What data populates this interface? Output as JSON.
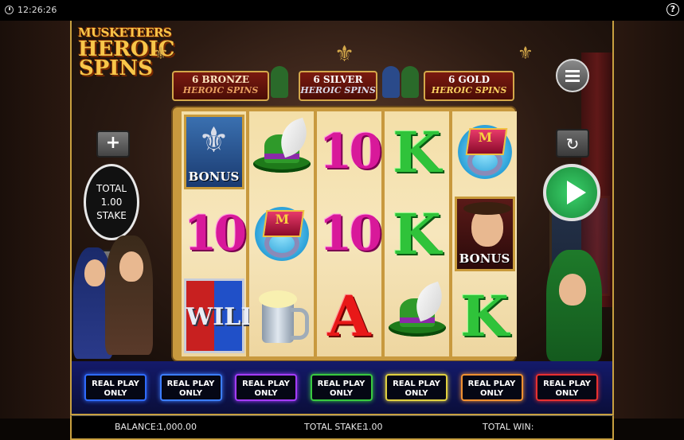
{
  "status": {
    "time": "12:26:26",
    "help_label": "?"
  },
  "logo": {
    "line1": "MUSKETEERS",
    "line2": "HEROIC",
    "line3": "SPINS"
  },
  "banner": {
    "bronze": {
      "count": "6 BRONZE",
      "label": "HEROIC SPINS"
    },
    "silver": {
      "count": "6 SILVER",
      "label": "HEROIC SPINS"
    },
    "gold": {
      "count": "6 GOLD",
      "label": "HEROIC SPINS"
    }
  },
  "reels": [
    [
      "bonus-fleur",
      "ten",
      "wild"
    ],
    [
      "hat",
      "ring",
      "tankard"
    ],
    [
      "ten",
      "ten",
      "ace"
    ],
    [
      "king",
      "king",
      "hat"
    ],
    [
      "ring",
      "bonus-character",
      "king"
    ]
  ],
  "symbols": {
    "ten": "10",
    "king": "K",
    "ace": "A",
    "bonus": "BONUS",
    "wild": "WILD",
    "ring_letter": "M"
  },
  "stake_control": {
    "plus": "+",
    "minus": "−",
    "line1": "TOTAL",
    "value": "1.00",
    "line3": "STAKE"
  },
  "line_buttons": [
    {
      "line1": "REAL PLAY",
      "line2": "ONLY",
      "color": "#2f6bff"
    },
    {
      "line1": "REAL PLAY",
      "line2": "ONLY",
      "color": "#3c7dff"
    },
    {
      "line1": "REAL PLAY",
      "line2": "ONLY",
      "color": "#a43cff"
    },
    {
      "line1": "REAL PLAY",
      "line2": "ONLY",
      "color": "#38c940"
    },
    {
      "line1": "REAL PLAY",
      "line2": "ONLY",
      "color": "#e0d040"
    },
    {
      "line1": "REAL PLAY",
      "line2": "ONLY",
      "color": "#f09030"
    },
    {
      "line1": "REAL PLAY",
      "line2": "ONLY",
      "color": "#e83030"
    }
  ],
  "footer": {
    "balance_label": "BALANCE:",
    "balance_value": "1,000.00",
    "stake_label": "TOTAL STAKE:",
    "stake_value": "1.00",
    "win_label": "TOTAL WIN:",
    "win_value": ""
  },
  "icons": {
    "menu": "menu-icon",
    "autoplay": "autoplay-icon",
    "spin": "play-icon",
    "clock": "clock-icon",
    "help": "help-icon"
  }
}
